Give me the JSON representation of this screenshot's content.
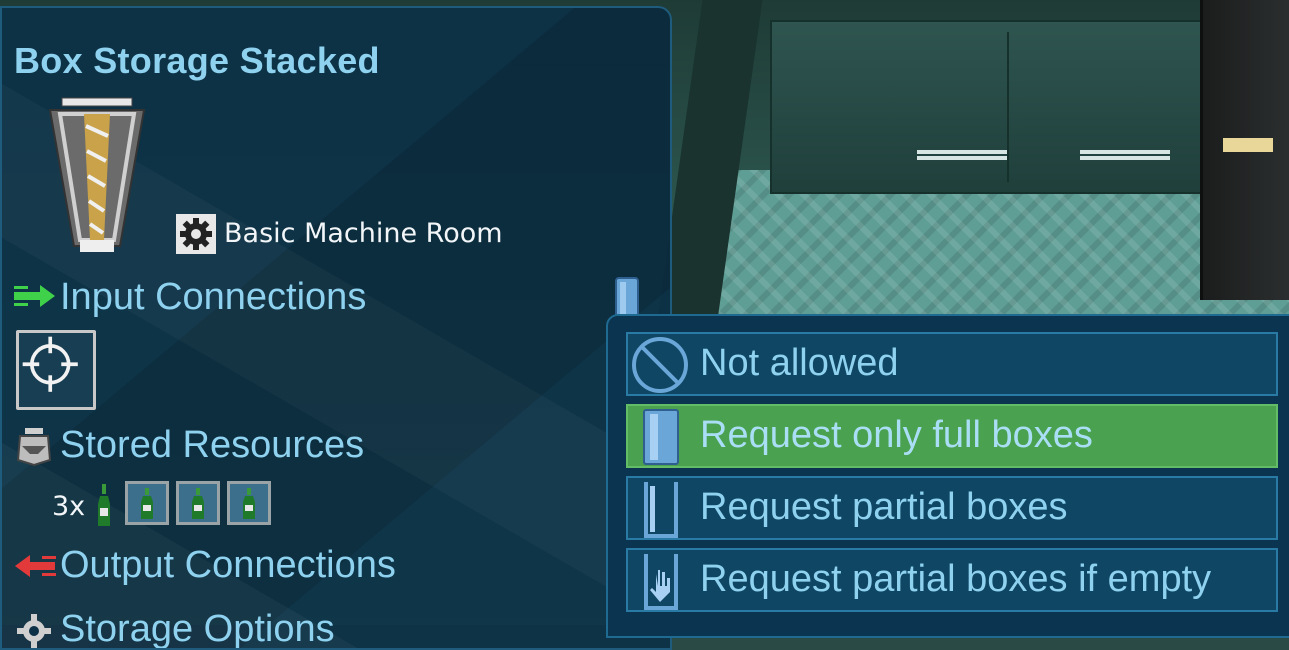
{
  "panel": {
    "title": "Box Storage Stacked",
    "room_label": "Basic Machine Room",
    "input_connections_label": "Input Connections",
    "stored_resources_label": "Stored Resources",
    "resource_count": "3x",
    "output_connections_label": "Output Connections",
    "storage_options_label": "Storage Options"
  },
  "dropdown": {
    "options": [
      {
        "label": "Not allowed",
        "icon": "no-entry-icon",
        "selected": false
      },
      {
        "label": "Request only full boxes",
        "icon": "full-box-icon",
        "selected": true
      },
      {
        "label": "Request partial boxes",
        "icon": "partial-box-icon",
        "selected": false
      },
      {
        "label": "Request partial boxes if empty",
        "icon": "partial-box-hand-icon",
        "selected": false
      }
    ]
  },
  "colors": {
    "accent_text": "#8fd2f0",
    "selected_option": "#4aa14f",
    "input_arrow": "#3fd14a",
    "output_arrow": "#e23a3a"
  }
}
